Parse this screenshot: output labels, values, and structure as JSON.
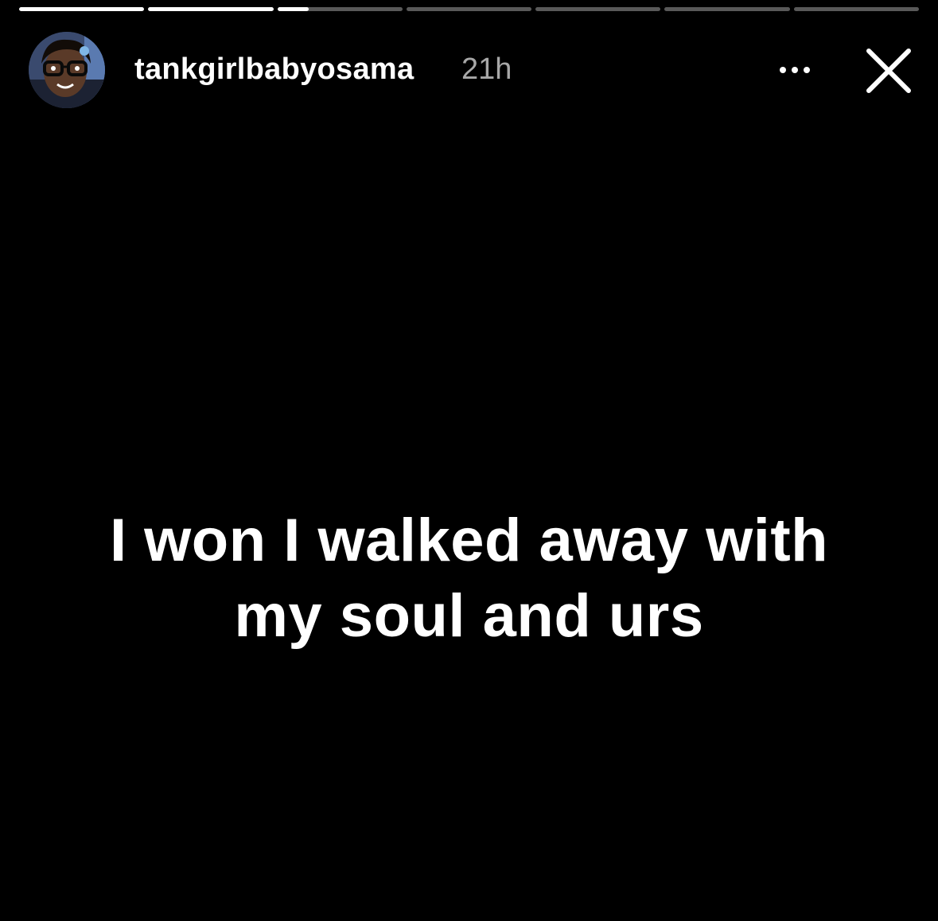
{
  "story": {
    "segments": [
      1,
      1,
      0.25,
      0,
      0,
      0,
      0
    ],
    "author": {
      "username": "tankgirlbabyosama",
      "timestamp": "21h",
      "avatar_icon": "profile-photo"
    },
    "text_lines": [
      "I won I walked away with",
      "my soul and urs"
    ]
  },
  "header": {
    "more_icon": "ellipsis-icon",
    "close_icon": "close-icon"
  },
  "colors": {
    "background": "#000000",
    "text": "#ffffff",
    "timestamp": "#a8a8a8",
    "progress_track": "rgba(255,255,255,0.35)",
    "progress_fill": "#ffffff"
  }
}
